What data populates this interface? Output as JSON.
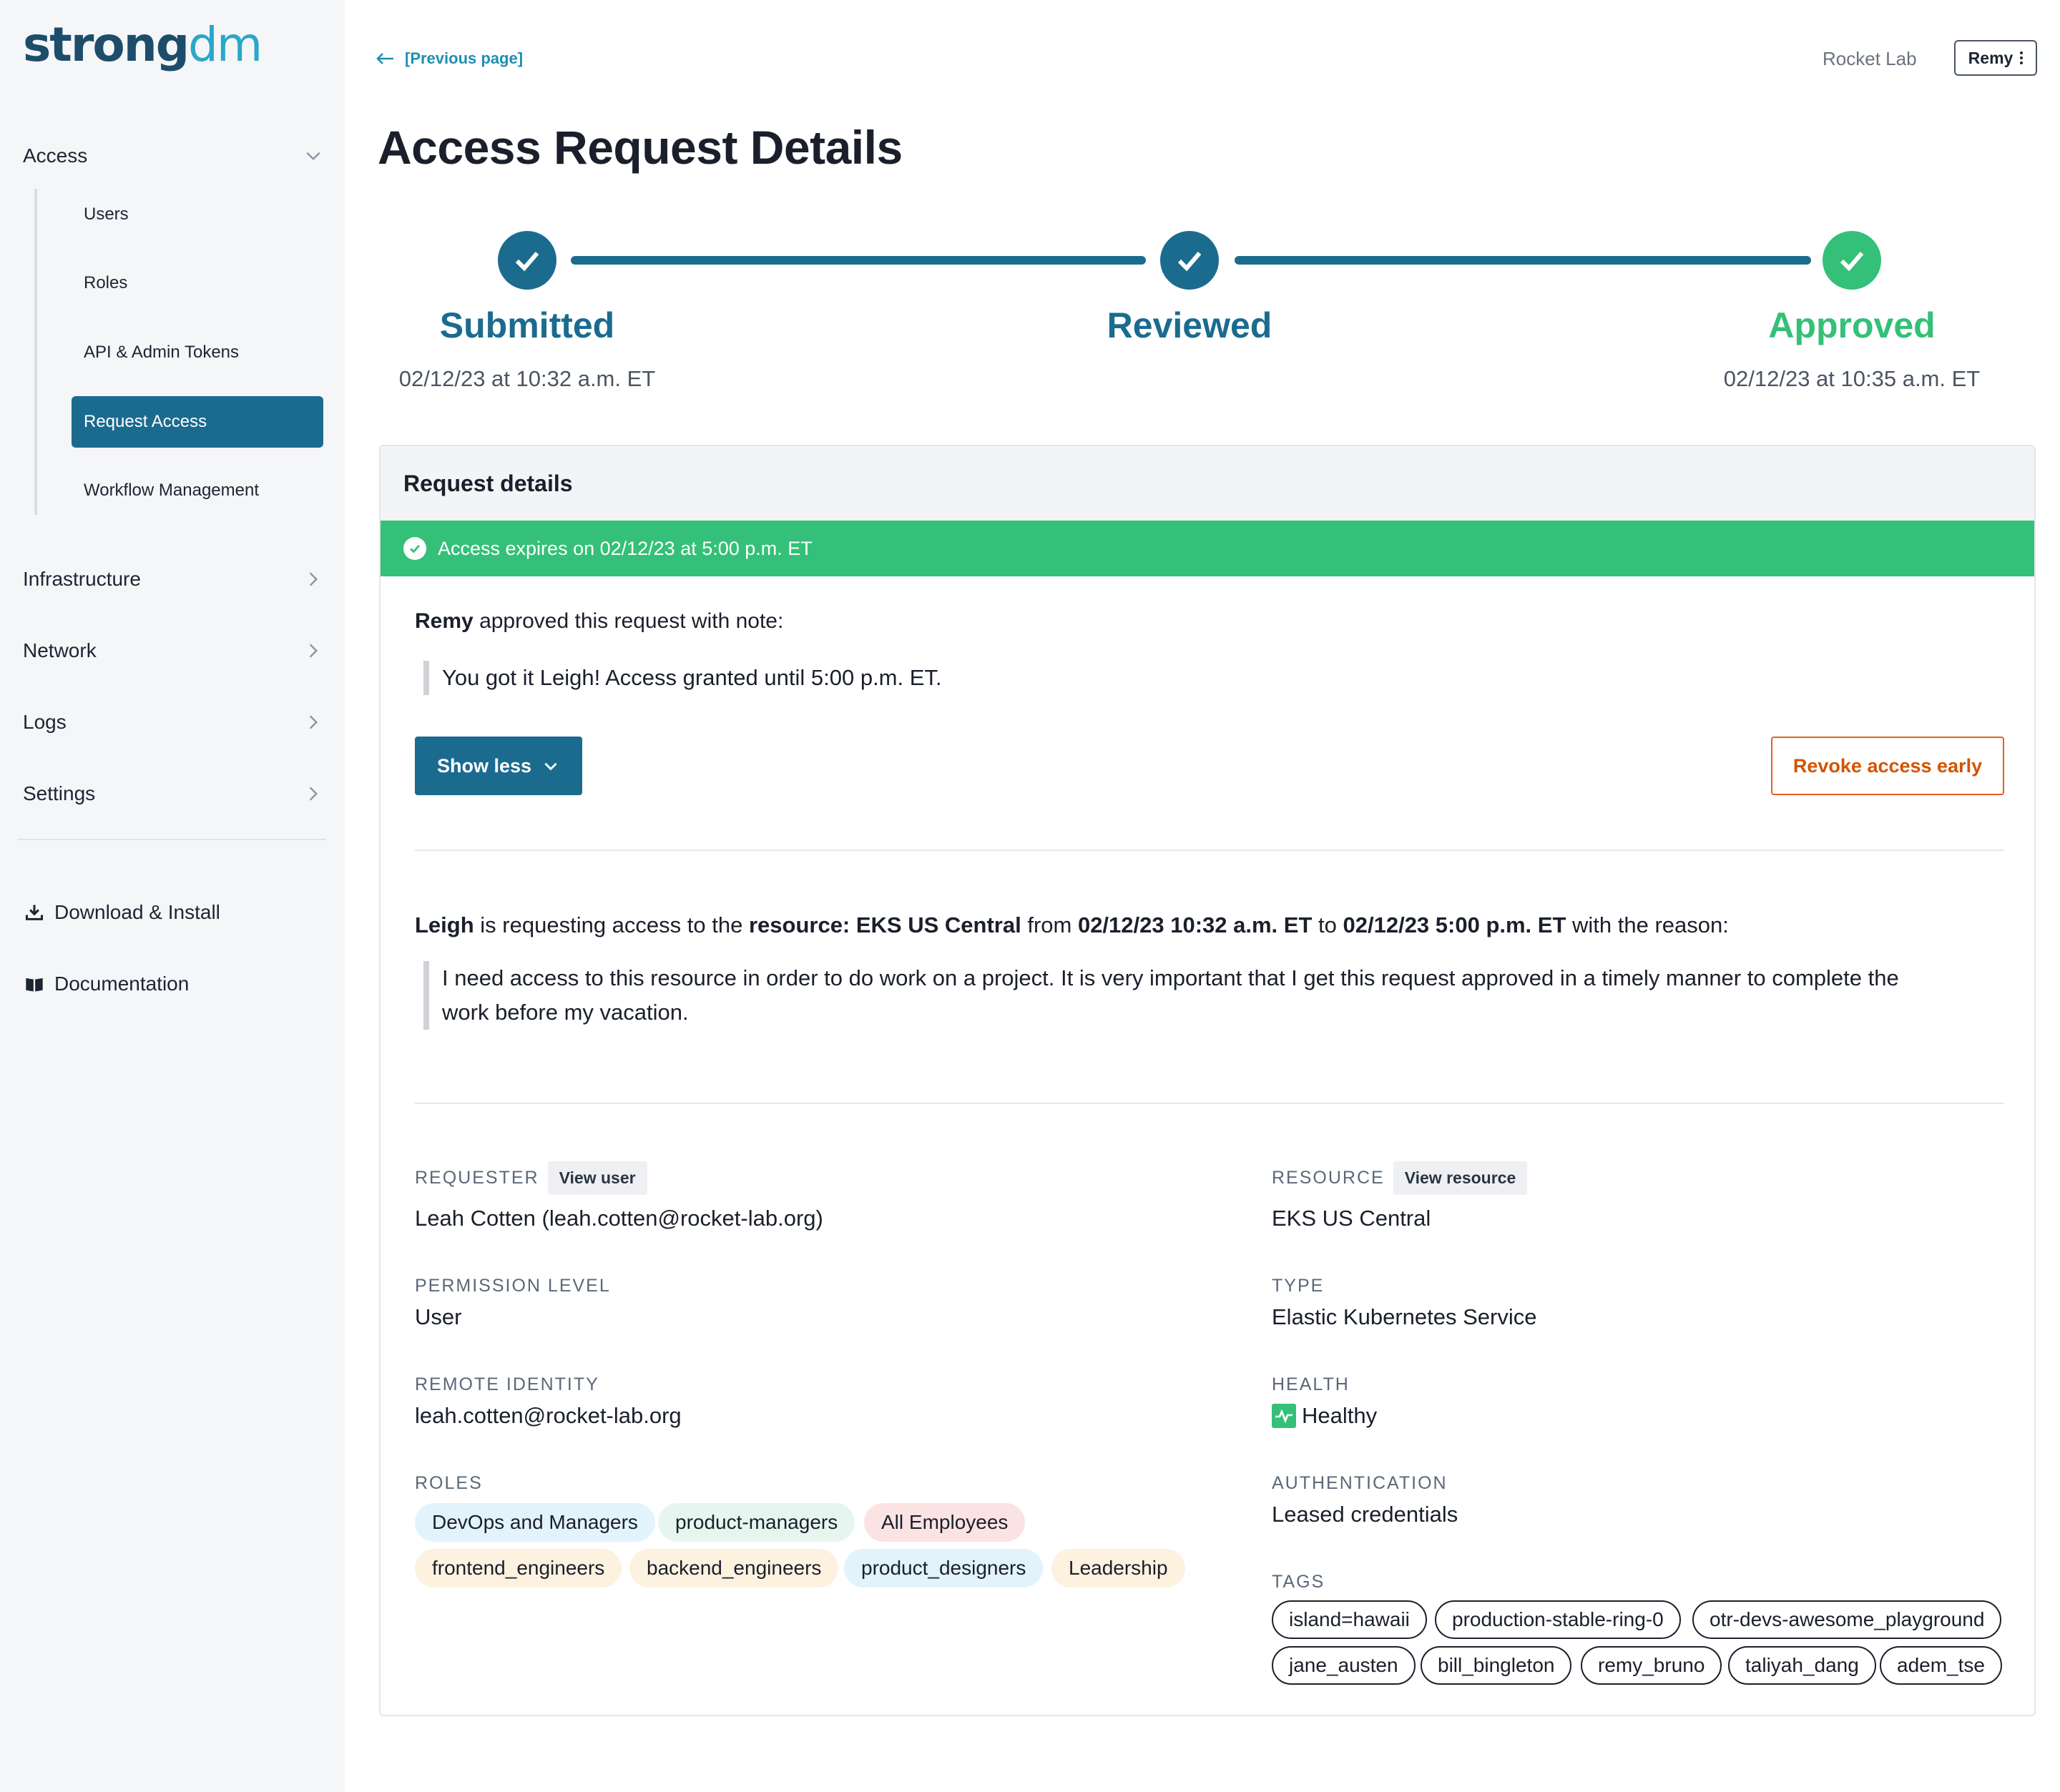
{
  "brand": {
    "logo_left": "strong",
    "logo_right": "dm"
  },
  "sidebar": {
    "sections": [
      {
        "label": "Access",
        "icon": "chevron-down-icon"
      },
      {
        "label": "Infrastructure",
        "icon": "chevron-right-icon"
      },
      {
        "label": "Network",
        "icon": "chevron-right-icon"
      },
      {
        "label": "Logs",
        "icon": "chevron-right-icon"
      },
      {
        "label": "Settings",
        "icon": "chevron-right-icon"
      }
    ],
    "access_items": [
      {
        "label": "Users"
      },
      {
        "label": "Roles"
      },
      {
        "label": "API & Admin Tokens"
      },
      {
        "label": "Request Access",
        "active": true
      },
      {
        "label": "Workflow Management"
      }
    ],
    "links": [
      {
        "label": "Download & Install",
        "icon": "download-icon"
      },
      {
        "label": "Documentation",
        "icon": "book-icon"
      }
    ]
  },
  "topbar": {
    "prev_label": "[Previous page]",
    "org": "Rocket Lab",
    "user": "Remy"
  },
  "page": {
    "title": "Access Request Details"
  },
  "progress": {
    "colors": {
      "primary": "#1b6b8f",
      "success": "#34c078"
    },
    "steps": [
      {
        "label": "Submitted",
        "date": "02/12/23 at 10:32 a.m. ET",
        "state": "complete"
      },
      {
        "label": "Reviewed",
        "date": "",
        "state": "complete"
      },
      {
        "label": "Approved",
        "date": "02/12/23 at 10:35 a.m. ET",
        "state": "approved"
      }
    ]
  },
  "details": {
    "heading": "Request details",
    "banner": "Access expires on 02/12/23 at 5:00 p.m. ET",
    "approver": "Remy",
    "approval_text": "approved this request with note:",
    "approval_note": "You got it Leigh! Access granted until 5:00 p.m. ET.",
    "show_less": "Show less",
    "revoke": "Revoke access early",
    "request": {
      "requester_short": "Leigh",
      "t1": "is requesting access to the",
      "resource_phrase": "resource: EKS US Central",
      "t2": "from",
      "from": "02/12/23 10:32 a.m. ET",
      "t3": "to",
      "to": "02/12/23 5:00 p.m. ET",
      "t4": "with the reason:",
      "reason_line1": "I need access to this resource in order to do work on a project. It is very important that I get this request approved in a timely manner to complete the",
      "reason_line2": "work before my vacation."
    },
    "requester": {
      "label": "REQUESTER",
      "link": "View user",
      "value": "Leah Cotten (leah.cotten@rocket-lab.org)"
    },
    "permission": {
      "label": "PERMISSION LEVEL",
      "value": "User"
    },
    "remote_identity": {
      "label": "REMOTE IDENTITY",
      "value": "leah.cotten@rocket-lab.org"
    },
    "roles": {
      "label": "ROLES",
      "items": [
        {
          "label": "DevOps and Managers",
          "color": "#e3f3fb"
        },
        {
          "label": "product-managers",
          "color": "#e6f6ee"
        },
        {
          "label": "All Employees",
          "color": "#fbe3e3"
        },
        {
          "label": "frontend_engineers",
          "color": "#fdf2e0"
        },
        {
          "label": "backend_engineers",
          "color": "#fdf2e0"
        },
        {
          "label": "product_designers",
          "color": "#e3f3fb"
        },
        {
          "label": "Leadership",
          "color": "#fdf2e0"
        }
      ]
    },
    "resource": {
      "label": "RESOURCE",
      "link": "View resource",
      "value": "EKS US Central"
    },
    "type": {
      "label": "TYPE",
      "value": "Elastic Kubernetes Service"
    },
    "health": {
      "label": "HEALTH",
      "value": "Healthy",
      "icon": "pulse-icon"
    },
    "authentication": {
      "label": "AUTHENTICATION",
      "value": "Leased credentials"
    },
    "tags": {
      "label": "TAGS",
      "items": [
        "island=hawaii",
        "production-stable-ring-0",
        "otr-devs-awesome_playground",
        "jane_austen",
        "bill_bingleton",
        "remy_bruno",
        "taliyah_dang",
        "adem_tse"
      ]
    }
  }
}
